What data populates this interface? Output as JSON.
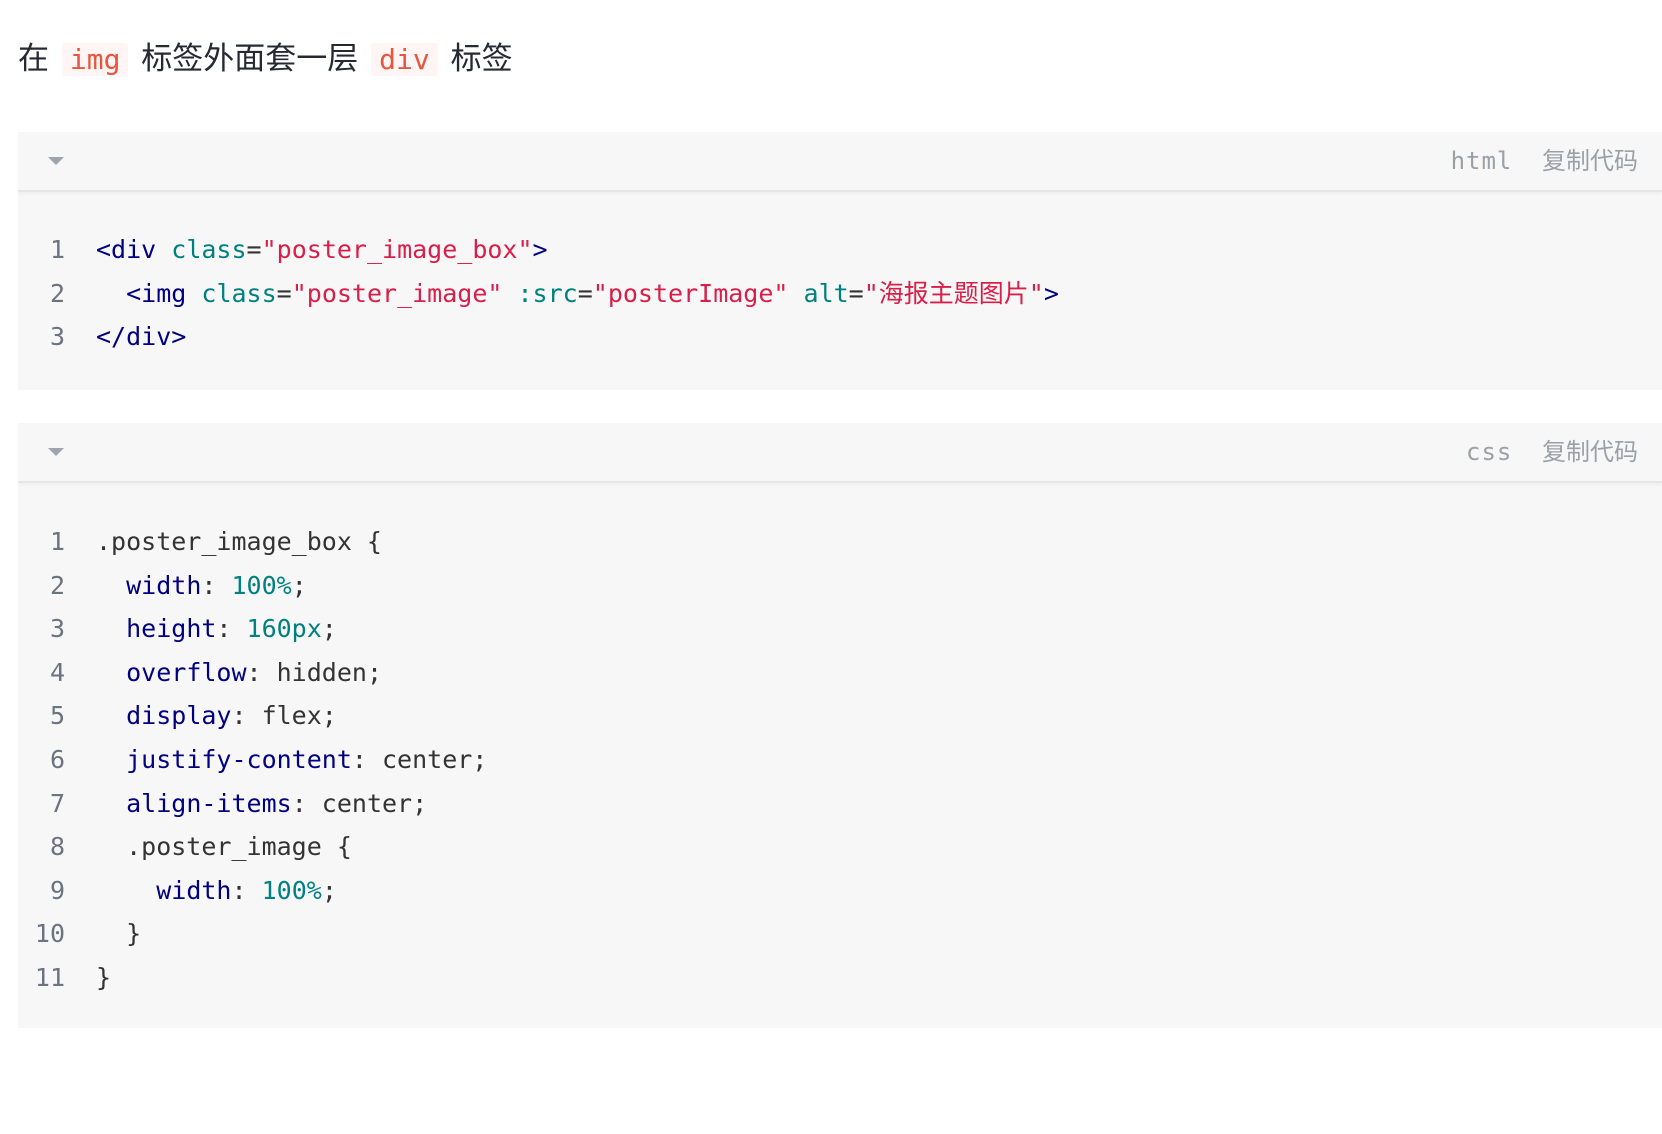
{
  "intro": {
    "prefix": "在",
    "code1": "img",
    "middle": "标签外面套一层",
    "code2": "div",
    "suffix": "标签"
  },
  "code_blocks": [
    {
      "language": "html",
      "copy_label": "复制代码",
      "lines": [
        {
          "number": "1",
          "tokens": [
            {
              "text": "<div",
              "type": "tag"
            },
            {
              "text": " ",
              "type": "plain"
            },
            {
              "text": "class",
              "type": "attr"
            },
            {
              "text": "=",
              "type": "plain"
            },
            {
              "text": "\"poster_image_box\"",
              "type": "str"
            },
            {
              "text": ">",
              "type": "tag"
            }
          ]
        },
        {
          "number": "2",
          "tokens": [
            {
              "text": "  ",
              "type": "plain"
            },
            {
              "text": "<img",
              "type": "tag"
            },
            {
              "text": " ",
              "type": "plain"
            },
            {
              "text": "class",
              "type": "attr"
            },
            {
              "text": "=",
              "type": "plain"
            },
            {
              "text": "\"poster_image\"",
              "type": "str"
            },
            {
              "text": " ",
              "type": "plain"
            },
            {
              "text": ":src",
              "type": "attr"
            },
            {
              "text": "=",
              "type": "plain"
            },
            {
              "text": "\"posterImage\"",
              "type": "str"
            },
            {
              "text": " ",
              "type": "plain"
            },
            {
              "text": "alt",
              "type": "attr"
            },
            {
              "text": "=",
              "type": "plain"
            },
            {
              "text": "\"海报主题图片\"",
              "type": "str"
            },
            {
              "text": ">",
              "type": "tag"
            }
          ]
        },
        {
          "number": "3",
          "tokens": [
            {
              "text": "</div>",
              "type": "tag"
            }
          ]
        }
      ]
    },
    {
      "language": "css",
      "copy_label": "复制代码",
      "lines": [
        {
          "number": "1",
          "tokens": [
            {
              "text": ".poster_image_box {",
              "type": "plain"
            }
          ]
        },
        {
          "number": "2",
          "tokens": [
            {
              "text": "  ",
              "type": "plain"
            },
            {
              "text": "width",
              "type": "prop"
            },
            {
              "text": ": ",
              "type": "plain"
            },
            {
              "text": "100%",
              "type": "num"
            },
            {
              "text": ";",
              "type": "plain"
            }
          ]
        },
        {
          "number": "3",
          "tokens": [
            {
              "text": "  ",
              "type": "plain"
            },
            {
              "text": "height",
              "type": "prop"
            },
            {
              "text": ": ",
              "type": "plain"
            },
            {
              "text": "160px",
              "type": "num"
            },
            {
              "text": ";",
              "type": "plain"
            }
          ]
        },
        {
          "number": "4",
          "tokens": [
            {
              "text": "  ",
              "type": "plain"
            },
            {
              "text": "overflow",
              "type": "prop"
            },
            {
              "text": ": hidden;",
              "type": "plain"
            }
          ]
        },
        {
          "number": "5",
          "tokens": [
            {
              "text": "  ",
              "type": "plain"
            },
            {
              "text": "display",
              "type": "prop"
            },
            {
              "text": ": flex;",
              "type": "plain"
            }
          ]
        },
        {
          "number": "6",
          "tokens": [
            {
              "text": "  ",
              "type": "plain"
            },
            {
              "text": "justify-content",
              "type": "prop"
            },
            {
              "text": ": center;",
              "type": "plain"
            }
          ]
        },
        {
          "number": "7",
          "tokens": [
            {
              "text": "  ",
              "type": "plain"
            },
            {
              "text": "align-items",
              "type": "prop"
            },
            {
              "text": ": center;",
              "type": "plain"
            }
          ]
        },
        {
          "number": "8",
          "tokens": [
            {
              "text": "  .poster_image {",
              "type": "plain"
            }
          ]
        },
        {
          "number": "9",
          "tokens": [
            {
              "text": "    ",
              "type": "plain"
            },
            {
              "text": "width",
              "type": "prop"
            },
            {
              "text": ": ",
              "type": "plain"
            },
            {
              "text": "100%",
              "type": "num"
            },
            {
              "text": ";",
              "type": "plain"
            }
          ]
        },
        {
          "number": "10",
          "tokens": [
            {
              "text": "  }",
              "type": "plain"
            }
          ]
        },
        {
          "number": "11",
          "tokens": [
            {
              "text": "}",
              "type": "plain"
            }
          ]
        }
      ]
    }
  ]
}
